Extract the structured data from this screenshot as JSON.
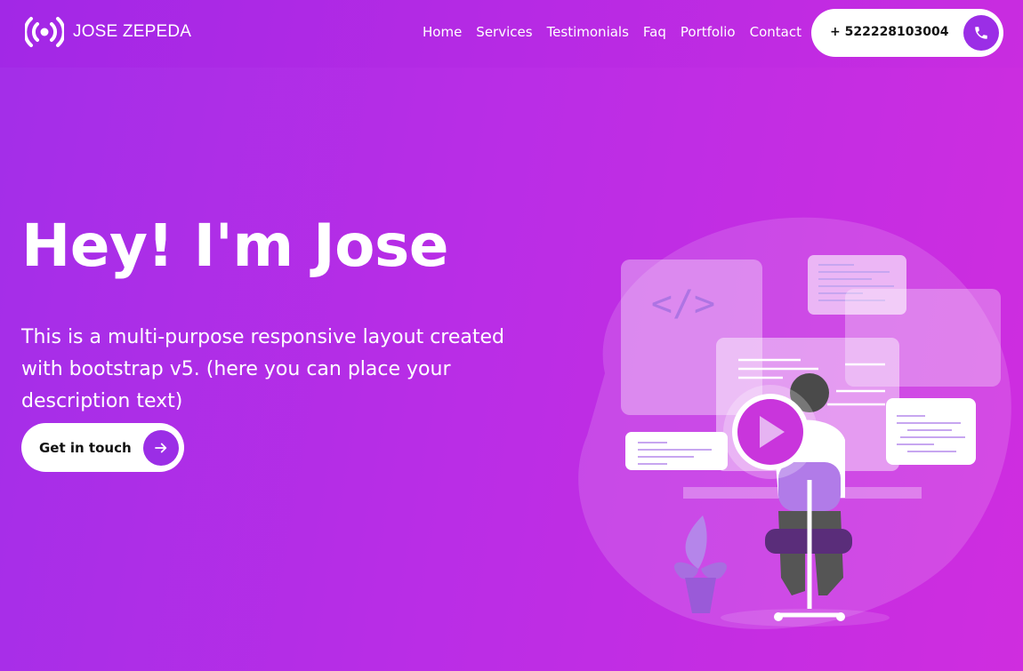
{
  "brand": {
    "name": "JOSE ZEPEDA",
    "icon": "broadcast-icon"
  },
  "nav": {
    "links": [
      "Home",
      "Services",
      "Testimonials",
      "Faq",
      "Portfolio",
      "Contact"
    ]
  },
  "phone": {
    "number": "+ 522228103004",
    "icon": "phone-icon"
  },
  "hero": {
    "title": "Hey! I'm Jose",
    "description": "This is a multi-purpose responsive layout created with bootstrap v5. (here you can place your description text)",
    "cta_label": "Get in touch",
    "cta_icon": "arrow-right-icon",
    "code_symbol": "</>"
  },
  "colors": {
    "accent": "#9b2ee6",
    "background_start": "#a32ee8",
    "background_end": "#cf2ddf"
  }
}
